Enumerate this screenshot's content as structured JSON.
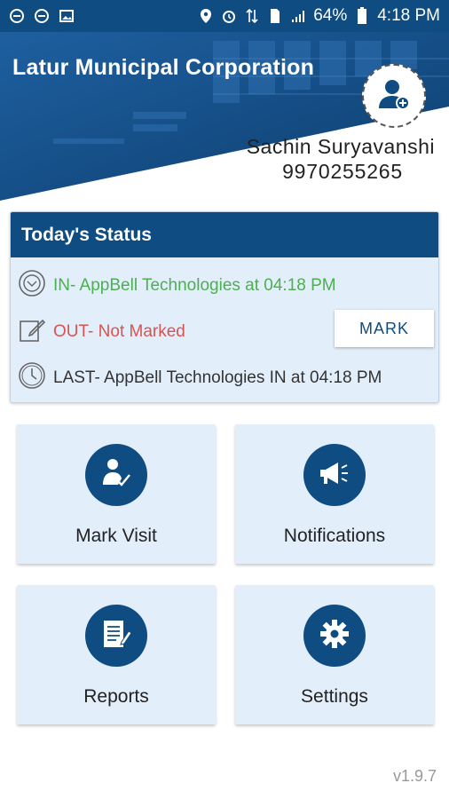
{
  "status_bar": {
    "battery": "64%",
    "time": "4:18 PM",
    "icons": [
      "notification-e-icon",
      "notification-e-icon",
      "image-icon",
      "location-icon",
      "alarm-icon",
      "data-icon",
      "sim-icon",
      "signal-icon",
      "battery-icon"
    ]
  },
  "header": {
    "org_name": "Latur Municipal Corporation",
    "user_name": "Sachin Suryavanshi",
    "user_phone": "9970255265",
    "avatar_icon": "add-user-icon"
  },
  "status": {
    "title": "Today's Status",
    "in_text": "IN- AppBell Technologies at 04:18 PM",
    "out_text": "OUT- Not Marked",
    "last_text": "LAST- AppBell Technologies IN at 04:18 PM",
    "mark_label": "MARK"
  },
  "tiles": [
    {
      "label": "Mark Visit",
      "icon": "mark-visit-icon"
    },
    {
      "label": "Notifications",
      "icon": "megaphone-icon"
    },
    {
      "label": "Reports",
      "icon": "report-icon"
    },
    {
      "label": "Settings",
      "icon": "gear-icon"
    }
  ],
  "version": "v1.9.7",
  "colors": {
    "primary": "#0f4c81",
    "card_bg": "#e3eefb",
    "in_green": "#4caf50",
    "out_red": "#d9534f"
  }
}
